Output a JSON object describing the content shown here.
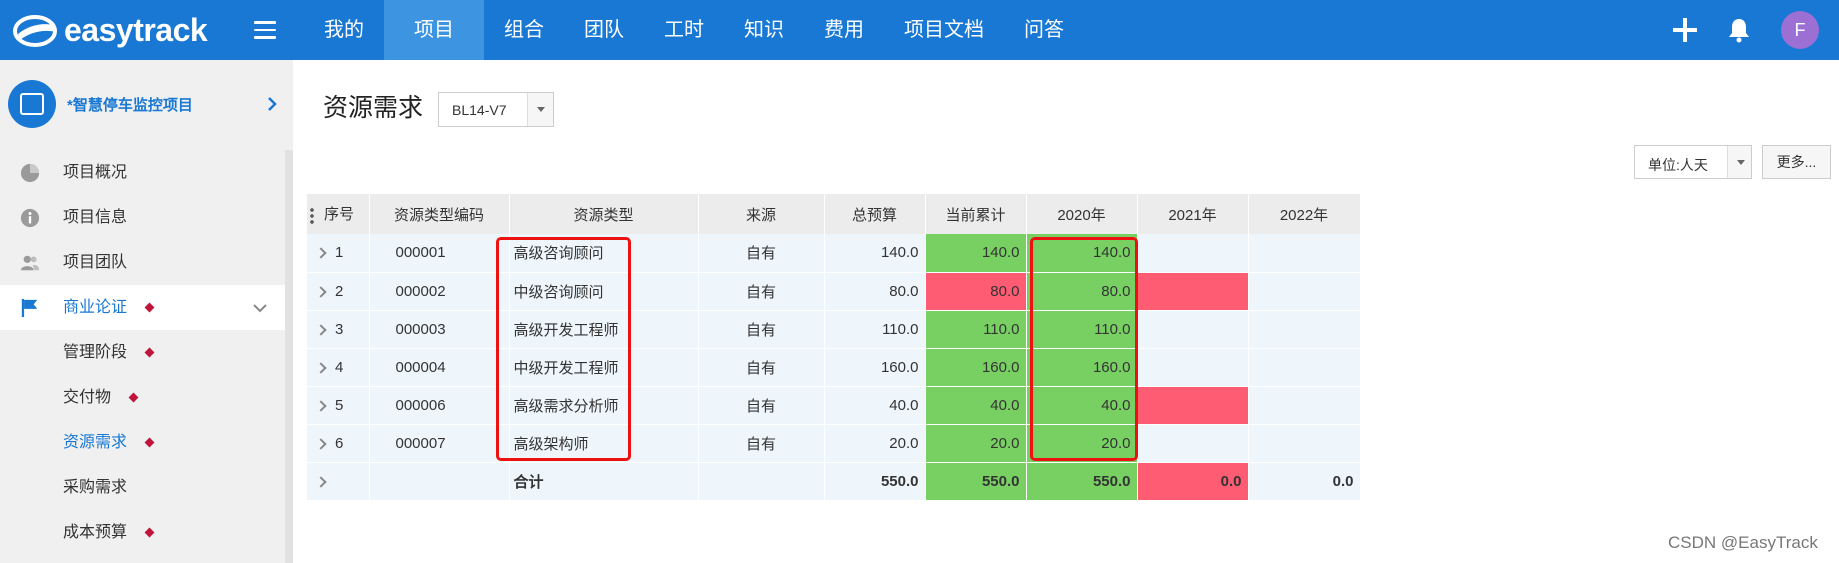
{
  "app": {
    "name": "easytrack"
  },
  "nav": [
    "我的",
    "项目",
    "组合",
    "团队",
    "工时",
    "知识",
    "费用",
    "项目文档",
    "问答"
  ],
  "nav_active_index": 1,
  "user": {
    "avatar_letter": "F",
    "avatar_color": "#9b6fd4"
  },
  "project": {
    "name": "*智慧停车监控项目"
  },
  "sidebar": {
    "items": [
      {
        "label": "项目概况",
        "icon": "pie-chart-icon"
      },
      {
        "label": "项目信息",
        "icon": "info-icon"
      },
      {
        "label": "项目团队",
        "icon": "team-icon"
      },
      {
        "label": "商业论证",
        "icon": "flag-icon"
      },
      {
        "label": "管理阶段"
      },
      {
        "label": "交付物"
      },
      {
        "label": "资源需求"
      },
      {
        "label": "采购需求"
      },
      {
        "label": "成本预算"
      }
    ]
  },
  "page": {
    "title": "资源需求",
    "version": "BL14-V7",
    "unit": "单位:人天",
    "more": "更多..."
  },
  "table": {
    "headers": [
      "序号",
      "资源类型编码",
      "资源类型",
      "来源",
      "总预算",
      "当前累计",
      "2020年",
      "2021年",
      "2022年"
    ],
    "rows": [
      {
        "no": "1",
        "code": "000001",
        "type": "高级咨询顾问",
        "source": "自有",
        "total": "140.0",
        "current": "140.0",
        "y2020": "140.0",
        "y2021": "",
        "y2022": "",
        "current_status": "green",
        "y2020_status": "green",
        "y2021_status": ""
      },
      {
        "no": "2",
        "code": "000002",
        "type": "中级咨询顾问",
        "source": "自有",
        "total": "80.0",
        "current": "80.0",
        "y2020": "80.0",
        "y2021": "",
        "y2022": "",
        "current_status": "red",
        "y2020_status": "green",
        "y2021_status": "red"
      },
      {
        "no": "3",
        "code": "000003",
        "type": "高级开发工程师",
        "source": "自有",
        "total": "110.0",
        "current": "110.0",
        "y2020": "110.0",
        "y2021": "",
        "y2022": "",
        "current_status": "green",
        "y2020_status": "green",
        "y2021_status": ""
      },
      {
        "no": "4",
        "code": "000004",
        "type": "中级开发工程师",
        "source": "自有",
        "total": "160.0",
        "current": "160.0",
        "y2020": "160.0",
        "y2021": "",
        "y2022": "",
        "current_status": "green",
        "y2020_status": "green",
        "y2021_status": ""
      },
      {
        "no": "5",
        "code": "000006",
        "type": "高级需求分析师",
        "source": "自有",
        "total": "40.0",
        "current": "40.0",
        "y2020": "40.0",
        "y2021": "",
        "y2022": "",
        "current_status": "green",
        "y2020_status": "green",
        "y2021_status": "red"
      },
      {
        "no": "6",
        "code": "000007",
        "type": "高级架构师",
        "source": "自有",
        "total": "20.0",
        "current": "20.0",
        "y2020": "20.0",
        "y2021": "",
        "y2022": "",
        "current_status": "green",
        "y2020_status": "green",
        "y2021_status": ""
      }
    ],
    "total": {
      "label": "合计",
      "total": "550.0",
      "current": "550.0",
      "y2020": "550.0",
      "y2021": "0.0",
      "y2022": "0.0",
      "current_status": "green",
      "y2020_status": "green",
      "y2021_status": "red"
    }
  },
  "colors": {
    "topbar": "#1878d4",
    "green": "#78d063",
    "red": "#fe5c72",
    "highlight": "#e11111"
  },
  "watermark": "CSDN @EasyTrack"
}
